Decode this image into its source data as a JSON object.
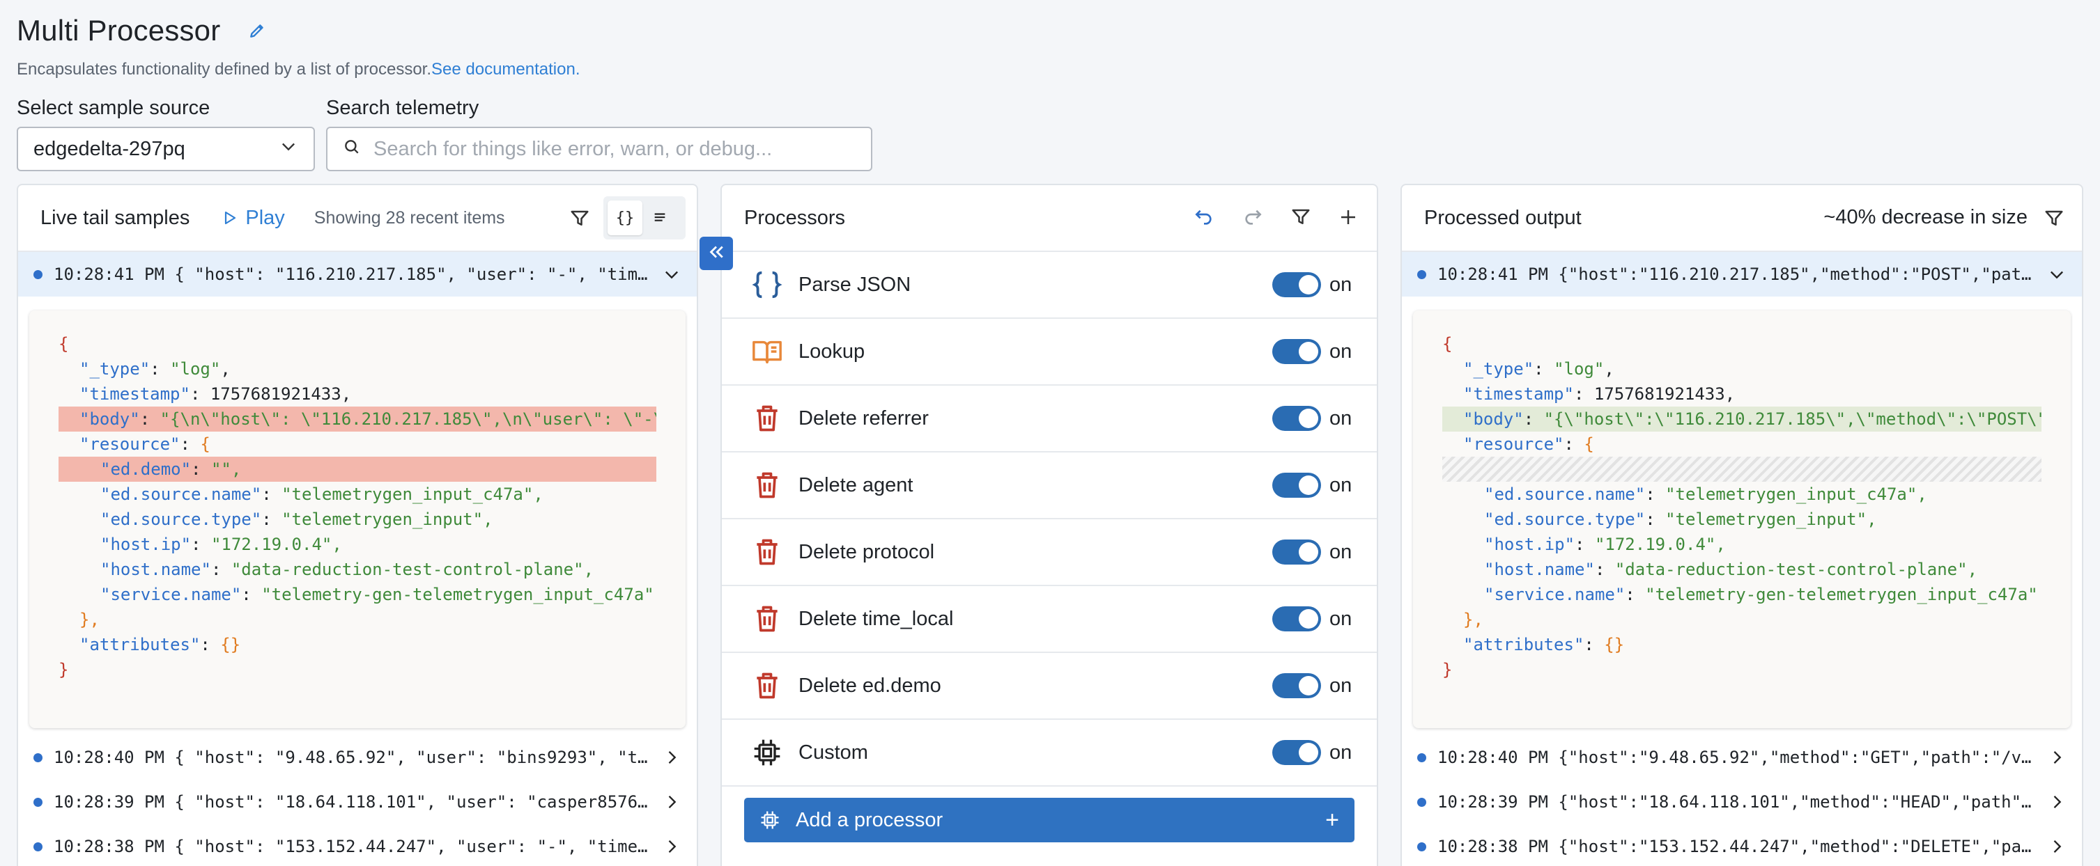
{
  "header": {
    "title": "Multi Processor",
    "subtitle": "Encapsulates functionality defined by a list of processor.",
    "doc_link": "See documentation."
  },
  "sample_source": {
    "label": "Select sample source",
    "value": "edgedelta-297pq"
  },
  "search": {
    "label": "Search telemetry",
    "placeholder": "Search for things like error, warn, or debug..."
  },
  "live_tail": {
    "title": "Live tail samples",
    "play_label": "Play",
    "showing": "Showing 28 recent items",
    "selected_row": "10:28:41 PM { \"host\": \"116.210.217.185\", \"user\": \"-\", \"tim…",
    "json": {
      "open": "{",
      "type_key": "\"_type\"",
      "type_val": "\"log\"",
      "ts_key": "\"timestamp\"",
      "ts_val": "1757681921433,",
      "body_key": "\"body\"",
      "body_val": "\"{\\n\\\"host\\\": \\\"116.210.217.185\\\",\\n\\\"user\\\": \\\"-\\\"",
      "res_key": "\"resource\"",
      "res_open": "{",
      "demo_key": "\"ed.demo\"",
      "demo_val": "\"\",",
      "src_name_key": "\"ed.source.name\"",
      "src_name_val": "\"telemetrygen_input_c47a\",",
      "src_type_key": "\"ed.source.type\"",
      "src_type_val": "\"telemetrygen_input\",",
      "ip_key": "\"host.ip\"",
      "ip_val": "\"172.19.0.4\",",
      "hostname_key": "\"host.name\"",
      "hostname_val": "\"data-reduction-test-control-plane\",",
      "svc_key": "\"service.name\"",
      "svc_val": "\"telemetry-gen-telemetrygen_input_c47a\"",
      "res_close": "},",
      "attr_key": "\"attributes\"",
      "attr_val": "{}",
      "close": "}"
    },
    "rows": [
      "10:28:40 PM { \"host\": \"9.48.65.92\", \"user\": \"bins9293\", \"t…",
      "10:28:39 PM { \"host\": \"18.64.118.101\", \"user\": \"casper8576…",
      "10:28:38 PM { \"host\": \"153.152.44.247\", \"user\": \"-\", \"time…"
    ]
  },
  "processors": {
    "title": "Processors",
    "toggle_label": "on",
    "items": [
      {
        "name": "Parse JSON",
        "icon": "braces-icon"
      },
      {
        "name": "Lookup",
        "icon": "book-icon"
      },
      {
        "name": "Delete referrer",
        "icon": "trash-icon"
      },
      {
        "name": "Delete agent",
        "icon": "trash-icon"
      },
      {
        "name": "Delete protocol",
        "icon": "trash-icon"
      },
      {
        "name": "Delete time_local",
        "icon": "trash-icon"
      },
      {
        "name": "Delete ed.demo",
        "icon": "trash-icon"
      },
      {
        "name": "Custom",
        "icon": "chip-icon"
      }
    ],
    "add_label": "Add a processor"
  },
  "output": {
    "title": "Processed output",
    "decrease": "~40% decrease in size",
    "selected_row": "10:28:41 PM {\"host\":\"116.210.217.185\",\"method\":\"POST\",\"pat…",
    "json": {
      "body_val": "\"{\\\"host\\\":\\\"116.210.217.185\\\",\\\"method\\\":\\\"POST\\\""
    },
    "rows": [
      "10:28:40 PM {\"host\":\"9.48.65.92\",\"method\":\"GET\",\"path\":\"/v…",
      "10:28:39 PM {\"host\":\"18.64.118.101\",\"method\":\"HEAD\",\"path\"…",
      "10:28:38 PM {\"host\":\"153.152.44.247\",\"method\":\"DELETE\",\"pa…"
    ]
  },
  "colors": {
    "accent": "#2f6fc9",
    "toggle": "#2a6cb3",
    "delete": "#c0392b",
    "lookup": "#e8883a"
  }
}
